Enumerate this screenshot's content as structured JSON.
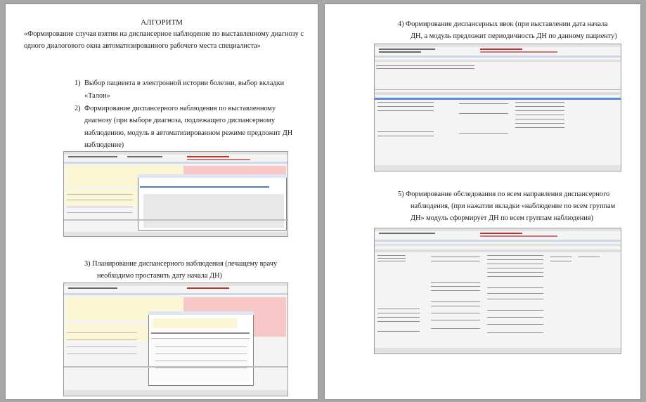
{
  "page1": {
    "heading": "АЛГОРИТМ",
    "intro": "«Формирование случая взятия на диспансерное наблюдение по выставленному диагнозу с одного диалогового окна автоматизированного рабочего места специалиста»",
    "step1": {
      "num": "1)",
      "line1": "Выбор пациента в электронной истории болезни, выбор вкладки",
      "line2": "«Талон»"
    },
    "step2": {
      "num": "2)",
      "line1": "Формирование диспансерного наблюдения по выставленному",
      "line2": "диагнозу (при выборе диагноза, подлежащего диспансерному",
      "line3": "наблюдению, модуль в автоматизированном режиме предложит ДН",
      "line4": "наблюдение)"
    },
    "step3": {
      "line1": "3) Планирование диспансерного наблюдения (лечащему врачу",
      "line2": "необходимо проставить дату начала ДН)"
    }
  },
  "page2": {
    "step4": {
      "line1": "4) Формирование диспансерных явок (при выставлении дата начала",
      "line2": "ДН, а модуль предложит периодичность ДН по данному пациенту)"
    },
    "step5": {
      "line1": "5) Формирование обследования по всем направления диспансерного",
      "line2": "наблюдения, (при нажатии вкладки «наблюдение по всем группам",
      "line3": "ДН» модуль сформирует ДН по всем группам наблюдения)"
    }
  }
}
